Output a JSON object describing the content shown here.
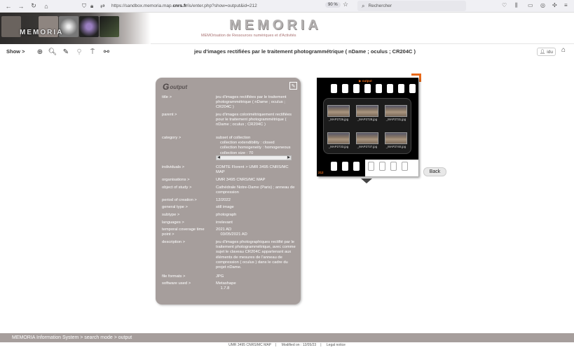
{
  "browser": {
    "url_prefix": "https://sandbox.memoria.map.",
    "url_domain": "cnrs.fr",
    "url_path": "/is/enter.php?show=output&id=212",
    "zoom": "90 %",
    "search_placeholder": "Rechercher"
  },
  "header": {
    "banner_text": "MEMORIA",
    "logo_title": "MEMORIA",
    "logo_subtitle": "MEMOrisation de Ressources numériques et d'Activités"
  },
  "toolbar": {
    "show_label": "Show >",
    "page_title": "jeu d'images rectifiées par le traitement photogrammétrique ( nDame ; oculus ; CR204C )",
    "user_label": "idu"
  },
  "card": {
    "heading": "output",
    "rows": [
      {
        "key": "title >",
        "value": "jeu d'images rectifiées par le traitement photogrammétrique ( nDame ; oculus ; CR204C )"
      },
      {
        "key": "parent >",
        "value": "jeu d'images colorimétriquement rectifiées pour le traitement photogrammétrique ( nDame ; oculus ; CR204C )"
      },
      {
        "key": "category >",
        "value": ""
      },
      {
        "key": "individuals >",
        "value": "COMTE Florent > UMR 3495 CNRS/MC MAP"
      },
      {
        "key": "organisations >",
        "value": "UMR 3495 CNRS/MC MAP"
      },
      {
        "key": "object of study >",
        "value": "Cathédrale Notre-Dame (Paris) ; anneau de compression"
      },
      {
        "key": "period of creation >",
        "value": "12/2022"
      },
      {
        "key": "general type >",
        "value": "still image"
      },
      {
        "key": "subtype >",
        "value": "photograph"
      },
      {
        "key": "languages >",
        "value": "irrelevant"
      },
      {
        "key": "temporal coverage time point >",
        "value": "2021 AD\n    03/05/2021 AD"
      },
      {
        "key": "description >",
        "value": "jeu d'images photographiques rectifié par le traitement photogrammétrique, avec comme sujet le claveau CR204C appartenant aux éléments de mesures de l'anneau de compression ( oculus ) dans le cadre du projet nDame."
      },
      {
        "key": "file formats >",
        "value": "JPG"
      },
      {
        "key": "software used >",
        "value": "Metashape\n    1.7.8"
      }
    ],
    "category": {
      "line1": "subset of collection",
      "line2": "collection extendibility :    closed",
      "line3": "collection homogeneity :   homogeneous",
      "line4": "collection size :              70"
    }
  },
  "film": {
    "label": "▶ output",
    "number": "212",
    "frames": [
      "_MAP2726.jpg",
      "_MAP2728.jpg",
      "_MAP2731.jpg",
      "_MAP2733.jpg",
      "_MAP2737.jpg",
      "_MAP2740.jpg"
    ]
  },
  "back_label": "Back",
  "footer": {
    "breadcrumb": "MEMORIA  Information System  >  search mode  >  output",
    "lab": "UMR 3495 CNRS/MC MAP",
    "modified": "Modified on : 12/05/23",
    "legal": "Legal notice"
  }
}
